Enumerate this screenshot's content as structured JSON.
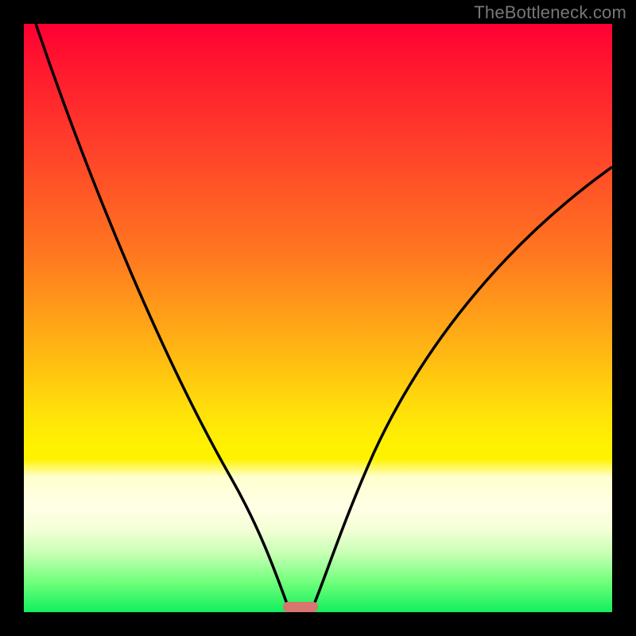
{
  "watermark": "TheBottleneck.com",
  "chart_data": {
    "type": "line",
    "title": "",
    "xlabel": "",
    "ylabel": "",
    "xlim": [
      0,
      1
    ],
    "ylim": [
      0,
      1
    ],
    "series": [
      {
        "name": "left-curve",
        "x": [
          0.02,
          0.05,
          0.1,
          0.15,
          0.2,
          0.25,
          0.3,
          0.35,
          0.4,
          0.42,
          0.44,
          0.45
        ],
        "y": [
          1.0,
          0.9,
          0.78,
          0.65,
          0.52,
          0.4,
          0.3,
          0.19,
          0.075,
          0.03,
          0.005,
          0.0
        ]
      },
      {
        "name": "right-curve",
        "x": [
          0.49,
          0.52,
          0.55,
          0.6,
          0.65,
          0.7,
          0.75,
          0.8,
          0.85,
          0.9,
          0.95,
          1.0
        ],
        "y": [
          0.0,
          0.03,
          0.1,
          0.23,
          0.34,
          0.43,
          0.5,
          0.57,
          0.63,
          0.68,
          0.72,
          0.76
        ]
      }
    ],
    "marker": {
      "name": "bottom-pill",
      "x_center": 0.47,
      "width": 0.06,
      "color": "#d7766f"
    },
    "gradient_stops": [
      {
        "pos": 0.0,
        "color": "#ff0033"
      },
      {
        "pos": 0.4,
        "color": "#ff7a1f"
      },
      {
        "pos": 0.66,
        "color": "#ffe10a"
      },
      {
        "pos": 0.82,
        "color": "#ffffe6"
      },
      {
        "pos": 1.0,
        "color": "#11ef5d"
      }
    ]
  }
}
